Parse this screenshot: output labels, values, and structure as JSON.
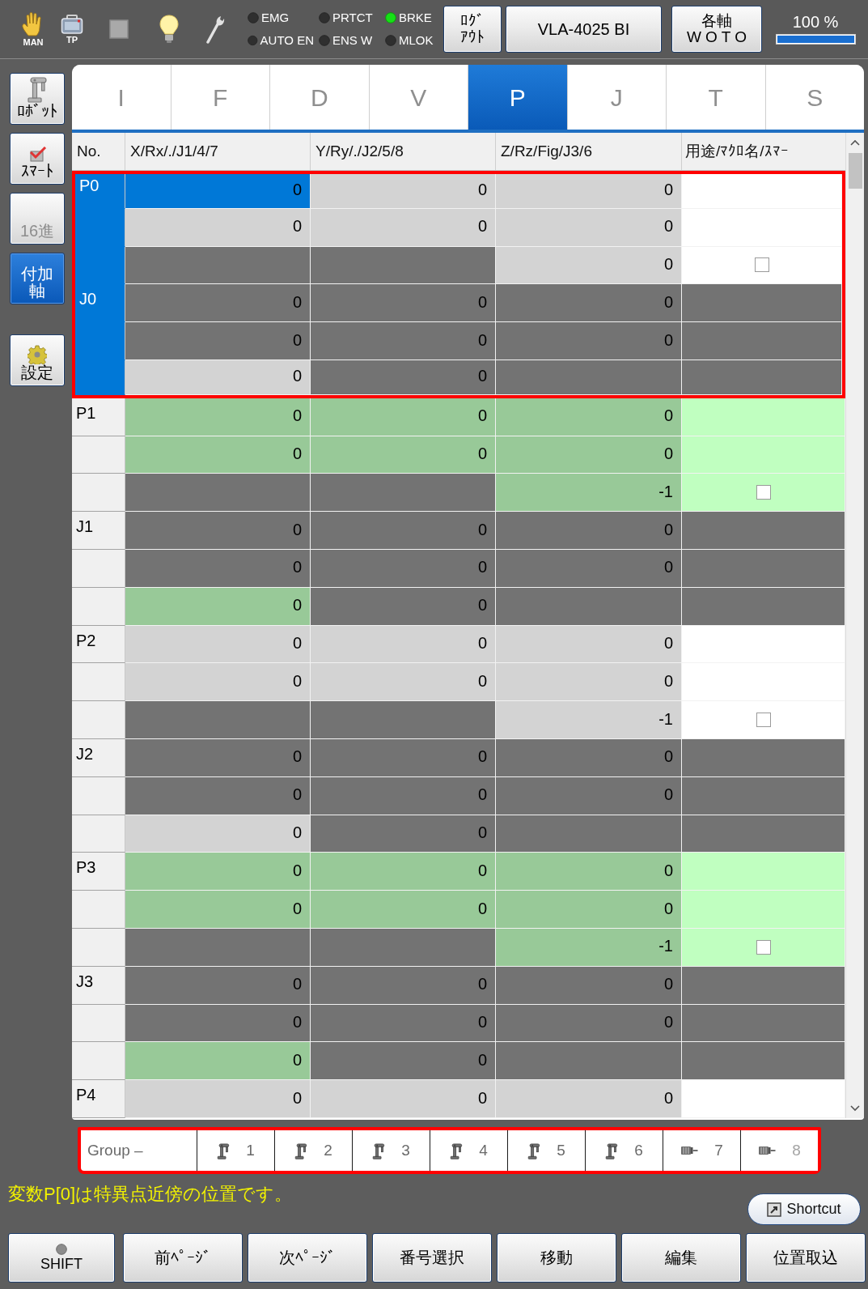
{
  "toolbar": {
    "mode_icons": [
      {
        "kind": "hand",
        "label": "MAN"
      },
      {
        "kind": "pendant",
        "label": "TP"
      },
      {
        "kind": "square"
      },
      {
        "kind": "bulb"
      },
      {
        "kind": "wrench"
      }
    ],
    "status_lights": [
      {
        "label": "EMG",
        "on": false
      },
      {
        "label": "AUTO EN",
        "on": false
      },
      {
        "label": "PRTCT",
        "on": false
      },
      {
        "label": "ENS W",
        "on": false
      },
      {
        "label": "BRKE",
        "on": true
      },
      {
        "label": "MLOK",
        "on": false
      }
    ],
    "logout_button": "ﾛｸﾞｱｳﾄ",
    "robot_button": "VLA-4025 BI",
    "axes_button": "各軸\nW O T O",
    "speed": {
      "reading": "100 %",
      "level": 1
    }
  },
  "sidebar": {
    "items": [
      {
        "kind": "robot",
        "label": "ﾛﾎﾞｯﾄ",
        "selected": false,
        "disabled": false
      },
      {
        "kind": "smart",
        "label": "ｽﾏｰﾄ",
        "selected": false,
        "disabled": false
      },
      {
        "kind": "plain",
        "label": "16進",
        "selected": false,
        "disabled": true
      },
      {
        "kind": "plain",
        "label": "付加軸",
        "selected": true,
        "disabled": false
      }
    ],
    "settings_button": {
      "kind": "gear",
      "label": "設定"
    }
  },
  "tabs": [
    {
      "label": "I",
      "selected": false
    },
    {
      "label": "F",
      "selected": false
    },
    {
      "label": "D",
      "selected": false
    },
    {
      "label": "V",
      "selected": false
    },
    {
      "label": "P",
      "selected": true
    },
    {
      "label": "J",
      "selected": false
    },
    {
      "label": "T",
      "selected": false
    },
    {
      "label": "S",
      "selected": false
    }
  ],
  "table": {
    "columns": [
      "No.",
      "X/Rx/./J1/4/7",
      "Y/Ry/./J2/5/8",
      "Z/Rz/Fig/J3/6",
      "用途/ﾏｸﾛ名/ｽﾏｰ"
    ],
    "groups": [
      {
        "selected": true,
        "shaded": false,
        "rows": [
          {
            "no": "P0",
            "cells": [
              {
                "kind": "value",
                "text": "0",
                "selected": true
              },
              {
                "kind": "value",
                "text": "0",
                "selected": false
              },
              {
                "kind": "value",
                "text": "0",
                "selected": false
              },
              {
                "kind": "note",
                "selected": false
              }
            ]
          },
          {
            "cells": [
              {
                "kind": "value",
                "text": "0",
                "selected": false
              },
              {
                "kind": "value",
                "text": "0",
                "selected": false
              },
              {
                "kind": "value",
                "text": "0",
                "selected": false
              },
              {
                "kind": "note",
                "selected": false
              }
            ]
          },
          {
            "cells": [
              {
                "kind": "unused",
                "selected": false
              },
              {
                "kind": "unused",
                "selected": false
              },
              {
                "kind": "value",
                "text": "0",
                "selected": false
              },
              {
                "kind": "check",
                "checked": false,
                "selected": false
              }
            ]
          },
          {
            "no": "J0",
            "cells": [
              {
                "kind": "unused",
                "text": "0",
                "selected": false
              },
              {
                "kind": "unused",
                "text": "0",
                "selected": false
              },
              {
                "kind": "unused",
                "text": "0",
                "selected": false
              },
              {
                "kind": "unused",
                "selected": false
              }
            ]
          },
          {
            "cells": [
              {
                "kind": "unused",
                "text": "0",
                "selected": false
              },
              {
                "kind": "unused",
                "text": "0",
                "selected": false
              },
              {
                "kind": "unused",
                "text": "0",
                "selected": false
              },
              {
                "kind": "unused",
                "selected": false
              }
            ]
          },
          {
            "cells": [
              {
                "kind": "value",
                "text": "0",
                "selected": false
              },
              {
                "kind": "unused",
                "text": "0",
                "selected": false
              },
              {
                "kind": "unused",
                "selected": false
              },
              {
                "kind": "unused",
                "selected": false
              }
            ]
          }
        ]
      },
      {
        "selected": false,
        "shaded": true,
        "rows": [
          {
            "no": "P1",
            "cells": [
              {
                "kind": "value",
                "text": "0",
                "selected": false
              },
              {
                "kind": "value",
                "text": "0",
                "selected": false
              },
              {
                "kind": "value",
                "text": "0",
                "selected": false
              },
              {
                "kind": "note",
                "selected": false
              }
            ]
          },
          {
            "cells": [
              {
                "kind": "value",
                "text": "0",
                "selected": false
              },
              {
                "kind": "value",
                "text": "0",
                "selected": false
              },
              {
                "kind": "value",
                "text": "0",
                "selected": false
              },
              {
                "kind": "note",
                "selected": false
              }
            ]
          },
          {
            "cells": [
              {
                "kind": "unused",
                "selected": false
              },
              {
                "kind": "unused",
                "selected": false
              },
              {
                "kind": "value",
                "text": "-1",
                "selected": false
              },
              {
                "kind": "check",
                "checked": false,
                "selected": false
              }
            ]
          },
          {
            "no": "J1",
            "cells": [
              {
                "kind": "unused",
                "text": "0",
                "selected": false
              },
              {
                "kind": "unused",
                "text": "0",
                "selected": false
              },
              {
                "kind": "unused",
                "text": "0",
                "selected": false
              },
              {
                "kind": "unused",
                "selected": false
              }
            ]
          },
          {
            "cells": [
              {
                "kind": "unused",
                "text": "0",
                "selected": false
              },
              {
                "kind": "unused",
                "text": "0",
                "selected": false
              },
              {
                "kind": "unused",
                "text": "0",
                "selected": false
              },
              {
                "kind": "unused",
                "selected": false
              }
            ]
          },
          {
            "cells": [
              {
                "kind": "value",
                "text": "0",
                "selected": false
              },
              {
                "kind": "unused",
                "text": "0",
                "selected": false
              },
              {
                "kind": "unused",
                "selected": false
              },
              {
                "kind": "unused",
                "selected": false
              }
            ]
          }
        ]
      },
      {
        "selected": false,
        "shaded": false,
        "rows": [
          {
            "no": "P2",
            "cells": [
              {
                "kind": "value",
                "text": "0",
                "selected": false
              },
              {
                "kind": "value",
                "text": "0",
                "selected": false
              },
              {
                "kind": "value",
                "text": "0",
                "selected": false
              },
              {
                "kind": "note",
                "selected": false
              }
            ]
          },
          {
            "cells": [
              {
                "kind": "value",
                "text": "0",
                "selected": false
              },
              {
                "kind": "value",
                "text": "0",
                "selected": false
              },
              {
                "kind": "value",
                "text": "0",
                "selected": false
              },
              {
                "kind": "note",
                "selected": false
              }
            ]
          },
          {
            "cells": [
              {
                "kind": "unused",
                "selected": false
              },
              {
                "kind": "unused",
                "selected": false
              },
              {
                "kind": "value",
                "text": "-1",
                "selected": false
              },
              {
                "kind": "check",
                "checked": false,
                "selected": false
              }
            ]
          },
          {
            "no": "J2",
            "cells": [
              {
                "kind": "unused",
                "text": "0",
                "selected": false
              },
              {
                "kind": "unused",
                "text": "0",
                "selected": false
              },
              {
                "kind": "unused",
                "text": "0",
                "selected": false
              },
              {
                "kind": "unused",
                "selected": false
              }
            ]
          },
          {
            "cells": [
              {
                "kind": "unused",
                "text": "0",
                "selected": false
              },
              {
                "kind": "unused",
                "text": "0",
                "selected": false
              },
              {
                "kind": "unused",
                "text": "0",
                "selected": false
              },
              {
                "kind": "unused",
                "selected": false
              }
            ]
          },
          {
            "cells": [
              {
                "kind": "value",
                "text": "0",
                "selected": false
              },
              {
                "kind": "unused",
                "text": "0",
                "selected": false
              },
              {
                "kind": "unused",
                "selected": false
              },
              {
                "kind": "unused",
                "selected": false
              }
            ]
          }
        ]
      },
      {
        "selected": false,
        "shaded": true,
        "rows": [
          {
            "no": "P3",
            "cells": [
              {
                "kind": "value",
                "text": "0",
                "selected": false
              },
              {
                "kind": "value",
                "text": "0",
                "selected": false
              },
              {
                "kind": "value",
                "text": "0",
                "selected": false
              },
              {
                "kind": "note",
                "selected": false
              }
            ]
          },
          {
            "cells": [
              {
                "kind": "value",
                "text": "0",
                "selected": false
              },
              {
                "kind": "value",
                "text": "0",
                "selected": false
              },
              {
                "kind": "value",
                "text": "0",
                "selected": false
              },
              {
                "kind": "note",
                "selected": false
              }
            ]
          },
          {
            "cells": [
              {
                "kind": "unused",
                "selected": false
              },
              {
                "kind": "unused",
                "selected": false
              },
              {
                "kind": "value",
                "text": "-1",
                "selected": false
              },
              {
                "kind": "check",
                "checked": false,
                "selected": false
              }
            ]
          },
          {
            "no": "J3",
            "cells": [
              {
                "kind": "unused",
                "text": "0",
                "selected": false
              },
              {
                "kind": "unused",
                "text": "0",
                "selected": false
              },
              {
                "kind": "unused",
                "text": "0",
                "selected": false
              },
              {
                "kind": "unused",
                "selected": false
              }
            ]
          },
          {
            "cells": [
              {
                "kind": "unused",
                "text": "0",
                "selected": false
              },
              {
                "kind": "unused",
                "text": "0",
                "selected": false
              },
              {
                "kind": "unused",
                "text": "0",
                "selected": false
              },
              {
                "kind": "unused",
                "selected": false
              }
            ]
          },
          {
            "cells": [
              {
                "kind": "value",
                "text": "0",
                "selected": false
              },
              {
                "kind": "unused",
                "text": "0",
                "selected": false
              },
              {
                "kind": "unused",
                "selected": false
              },
              {
                "kind": "unused",
                "selected": false
              }
            ]
          }
        ]
      },
      {
        "selected": false,
        "shaded": false,
        "rows": [
          {
            "no": "P4",
            "cells": [
              {
                "kind": "value",
                "text": "0",
                "selected": false
              },
              {
                "kind": "value",
                "text": "0",
                "selected": false
              },
              {
                "kind": "value",
                "text": "0",
                "selected": false
              },
              {
                "kind": "note",
                "selected": false
              }
            ]
          }
        ]
      }
    ]
  },
  "group_bar": {
    "label": "Group –",
    "framed": true,
    "items": [
      {
        "kind": "arm",
        "label": "1",
        "disabled": false
      },
      {
        "kind": "arm",
        "label": "2",
        "disabled": false
      },
      {
        "kind": "arm",
        "label": "3",
        "disabled": false
      },
      {
        "kind": "arm",
        "label": "4",
        "disabled": false
      },
      {
        "kind": "arm",
        "label": "5",
        "disabled": false
      },
      {
        "kind": "arm",
        "label": "6",
        "disabled": false
      },
      {
        "kind": "axis",
        "label": "7",
        "disabled": false
      },
      {
        "kind": "axis",
        "label": "8",
        "disabled": true
      }
    ]
  },
  "message": "変数P[0]は特異点近傍の位置です。",
  "shortcut_button": "Shortcut",
  "shift_button": {
    "label": "SHIFT",
    "on": false
  },
  "footer_buttons": [
    "前ﾍﾟｰｼﾞ",
    "次ﾍﾟｰｼﾞ",
    "番号選択",
    "移動",
    "編集",
    "位置取込"
  ]
}
